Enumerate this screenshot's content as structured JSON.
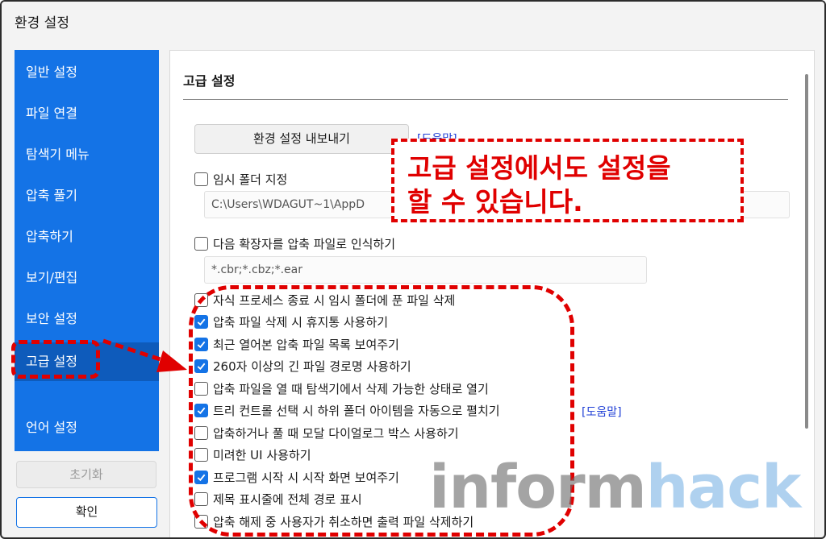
{
  "window": {
    "title": "환경 설정"
  },
  "sidebar": {
    "items": [
      {
        "label": "일반 설정"
      },
      {
        "label": "파일 연결"
      },
      {
        "label": "탐색기 메뉴"
      },
      {
        "label": "압축 풀기"
      },
      {
        "label": "압축하기"
      },
      {
        "label": "보기/편집"
      },
      {
        "label": "보안 설정"
      },
      {
        "label": "고급 설정",
        "active": true
      },
      {
        "label": "언어 설정"
      }
    ],
    "reset_label": "초기화",
    "ok_label": "확인"
  },
  "panel": {
    "title": "고급 설정",
    "export_label": "환경 설정 내보내기",
    "help_label": "[도움말]",
    "temp_folder": {
      "label": "임시 폴더 지정",
      "checked": false,
      "value": "C:\\Users\\WDAGUT~1\\AppD"
    },
    "ext_option": {
      "label": "다음 확장자를 압축 파일로 인식하기",
      "checked": false,
      "value": "*.cbr;*.cbz;*.ear"
    },
    "options": [
      {
        "label": "자식 프로세스 종료 시 임시 폴더에 푼 파일 삭제",
        "checked": false
      },
      {
        "label": "압축 파일 삭제 시 휴지통 사용하기",
        "checked": true
      },
      {
        "label": "최근 열어본 압축 파일 목록 보여주기",
        "checked": true
      },
      {
        "label": "260자 이상의 긴 파일 경로명 사용하기",
        "checked": true
      },
      {
        "label": "압축 파일을 열 때 탐색기에서 삭제 가능한 상태로 열기",
        "checked": false
      },
      {
        "label": "트리 컨트롤 선택 시 하위 폴더 아이템을 자동으로 펼치기",
        "checked": true
      },
      {
        "label": "압축하거나 풀 때 모달 다이얼로그 박스 사용하기",
        "checked": false
      },
      {
        "label": "미려한 UI 사용하기",
        "checked": false
      },
      {
        "label": "프로그램 시작 시 시작 화면 보여주기",
        "checked": true
      },
      {
        "label": "제목 표시줄에 전체 경로 표시",
        "checked": false
      },
      {
        "label": "압축 해제 중 사용자가 취소하면 출력 파일 삭제하기",
        "checked": false
      }
    ],
    "tree_help_label": "[도움말]"
  },
  "annotation": {
    "callout_line1": "고급 설정에서도 설정을",
    "callout_line2": "할 수 있습니다.",
    "color": "#e00000"
  },
  "watermark": {
    "part1": "inform",
    "part2": "hack"
  }
}
